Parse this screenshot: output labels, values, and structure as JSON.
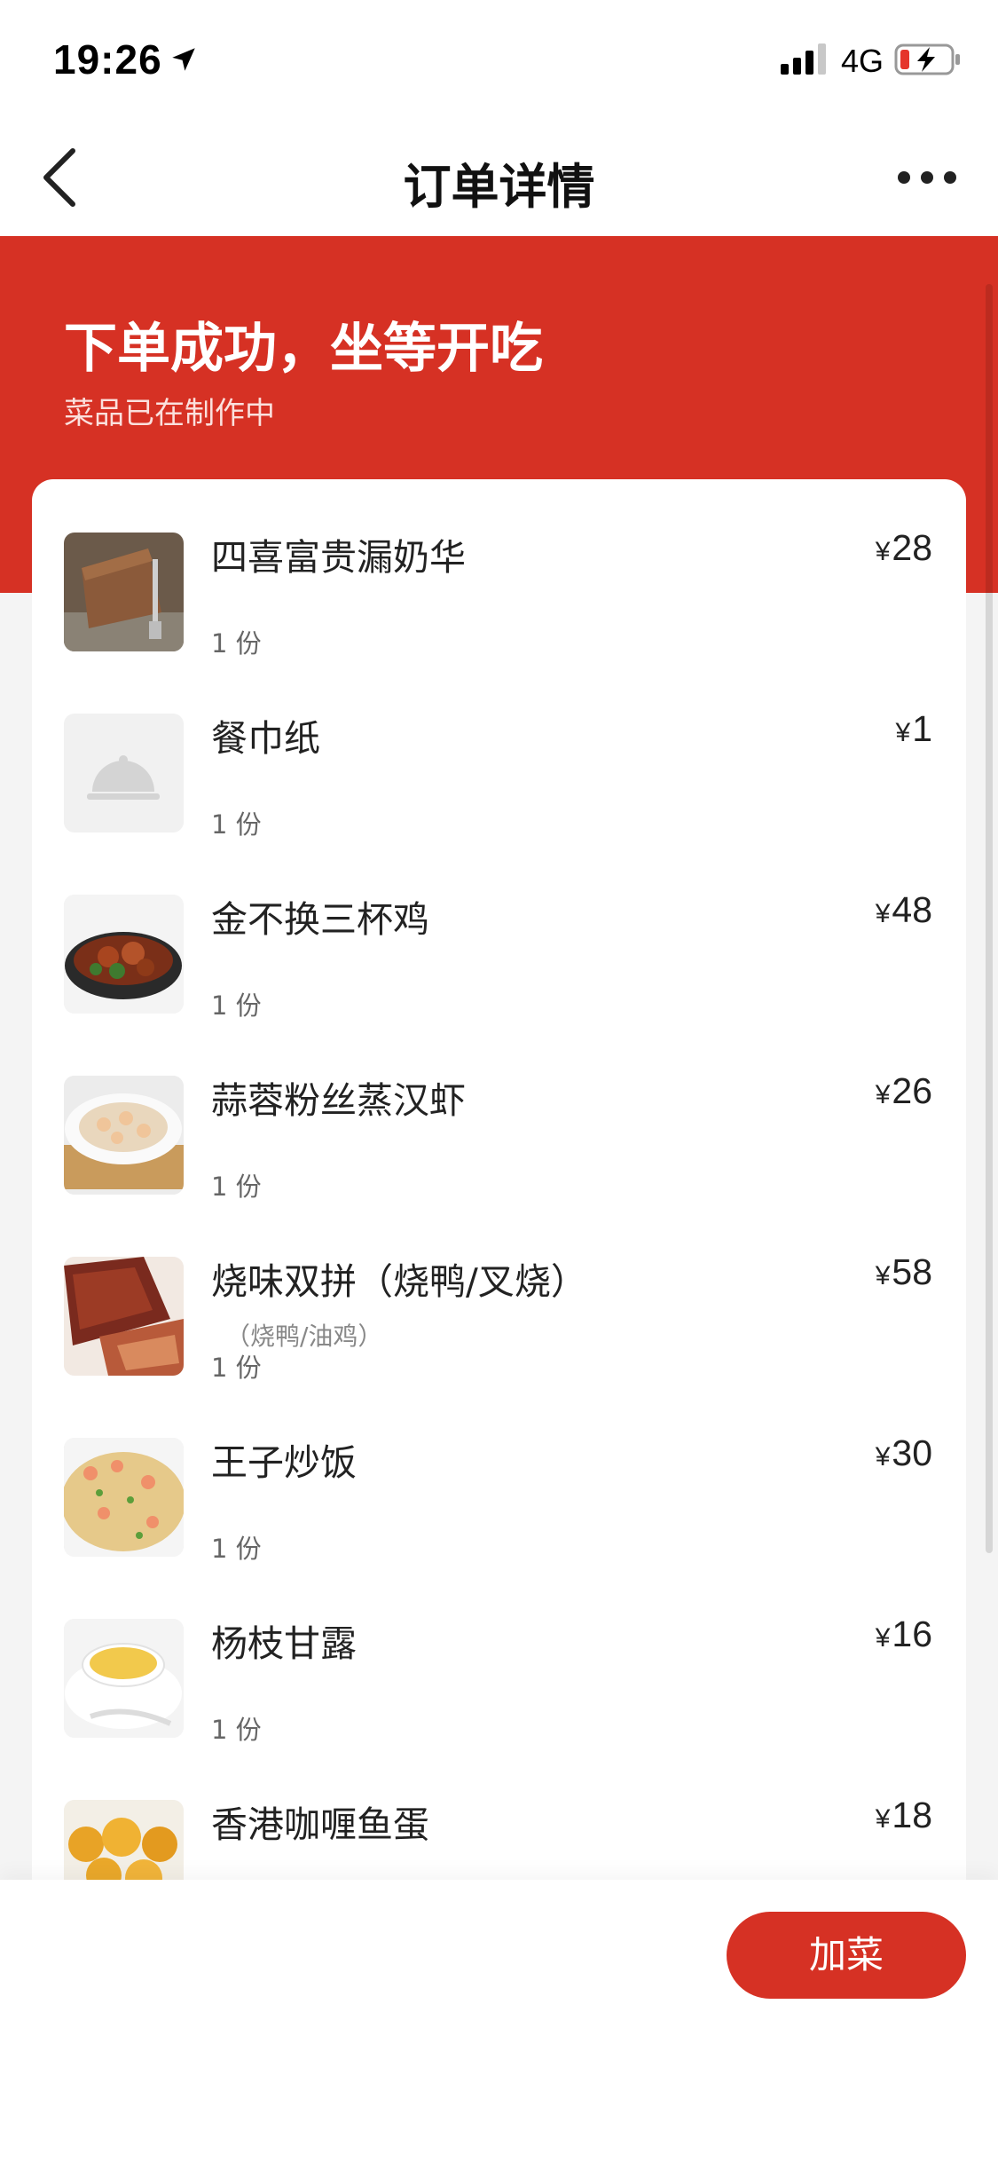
{
  "status_bar": {
    "time": "19:26",
    "network": "4G",
    "icons": [
      "location-arrow-icon",
      "signal-icon",
      "battery-charging-icon"
    ]
  },
  "nav": {
    "title": "订单详情",
    "back_icon": "chevron-left-icon",
    "more_icon": "more-dots-icon"
  },
  "banner": {
    "title": "下单成功，坐等开吃",
    "subtitle": "菜品已在制作中",
    "color": "#d63124"
  },
  "currency": "¥",
  "items": [
    {
      "name": "四喜富贵漏奶华",
      "spec": "",
      "qty": "1 份",
      "price": "28",
      "thumb": "dessert-photo"
    },
    {
      "name": "餐巾纸",
      "spec": "",
      "qty": "1 份",
      "price": "1",
      "thumb": "placeholder-cloche-icon"
    },
    {
      "name": "金不换三杯鸡",
      "spec": "",
      "qty": "1 份",
      "price": "48",
      "thumb": "chicken-pot-photo"
    },
    {
      "name": "蒜蓉粉丝蒸汉虾",
      "spec": "",
      "qty": "1 份",
      "price": "26",
      "thumb": "steamed-shrimp-photo"
    },
    {
      "name": "烧味双拼（烧鸭/叉烧）",
      "spec": "（烧鸭/油鸡）",
      "qty": "1 份",
      "price": "58",
      "thumb": "roast-meat-photo"
    },
    {
      "name": "王子炒饭",
      "spec": "",
      "qty": "1 份",
      "price": "30",
      "thumb": "fried-rice-photo"
    },
    {
      "name": "杨枝甘露",
      "spec": "",
      "qty": "1 份",
      "price": "16",
      "thumb": "mango-dessert-photo"
    },
    {
      "name": "香港咖喱鱼蛋",
      "spec": "",
      "qty": "",
      "price": "18",
      "thumb": "curry-fishball-photo"
    }
  ],
  "actions": {
    "add_dish_label": "加菜"
  }
}
